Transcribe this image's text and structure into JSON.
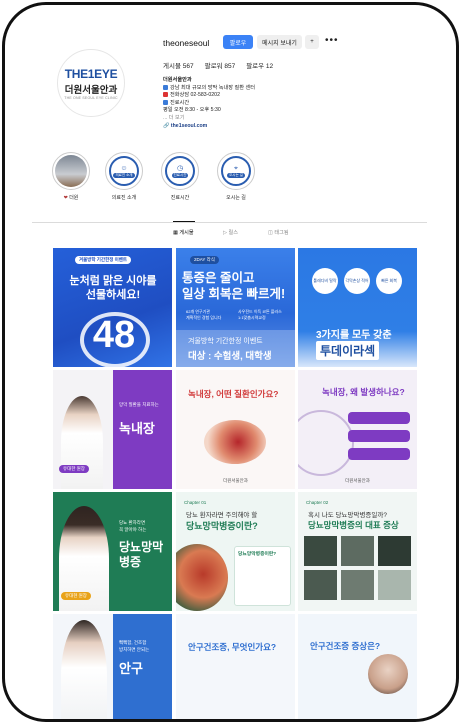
{
  "profile": {
    "username": "theoneseoul",
    "follow_label": "팔로우",
    "message_label": "메시지 보내기",
    "person_icon": "+",
    "more_icon": "•••",
    "avatar_logo": "THE1EYE",
    "avatar_name": "더원서울안과",
    "avatar_sub": "THE ONE SEOUL EYE CLINIC",
    "stats": {
      "posts": "게시물 567",
      "followers": "팔로워 857",
      "following": "팔로우 12"
    },
    "bio": {
      "name": "더원서울안과",
      "line1": "강남 최대 규모의 망막 녹내장 질환 센터",
      "line2": "전화상담 02-583-0202",
      "line3": "진료시간",
      "line4": "평일 오전 8:30 - 오후 5:30",
      "more": "... 더 보기",
      "link": "the1seoul.com"
    }
  },
  "highlights": [
    {
      "label": "더원",
      "type": "photo"
    },
    {
      "label": "의료진 소개",
      "type": "badge",
      "badge": "의료진 소개"
    },
    {
      "label": "진료시간",
      "type": "badge",
      "badge": "진료시간"
    },
    {
      "label": "오시는 길",
      "type": "badge",
      "badge": "오시는 길"
    }
  ],
  "tabs": [
    {
      "label": "게시물",
      "active": true
    },
    {
      "label": "릴스",
      "active": false
    },
    {
      "label": "태그됨",
      "active": false
    }
  ],
  "posts": {
    "p1": {
      "tag": "겨울방학 기간한정 이벤트",
      "l1": "눈처럼 맑은 시야를",
      "l2": "선물하세요!",
      "big": "48"
    },
    "p2": {
      "tag": "2DAY 라식",
      "l1": "통증은 줄이고",
      "l2": "일상 회복은 빠르게!",
      "a1": "62개 연구기관",
      "a2": "계획적인 경험 입니다",
      "b1": "사우전드 이득 코튼 플러스",
      "b2": "1:1맞춤시력교정",
      "e1": "겨울방학 기간한정 이벤트",
      "e2": "대상 : 수험생, 대학생"
    },
    "p3": {
      "c1": "톨레디비 탈락",
      "c2": "각막손상 적어",
      "c3": "빠른 회복",
      "l1": "3가지를 모두 갖춘",
      "l2": "투데이라섹"
    },
    "p4": {
      "small1": "망막 질환을 치료하는",
      "small2": "녹내장",
      "big": "녹내장",
      "badge": "유대한 원장"
    },
    "p5": {
      "l1": "녹내장, 어떤 질환인가요?",
      "footer": "더원서울안과"
    },
    "p6": {
      "l1": "녹내장, 왜 발생하나요?",
      "footer": "더원서울안과"
    },
    "p7": {
      "small1": "당뇨 환자라면",
      "small2": "꼭 알아야 하는",
      "big1": "당뇨망막",
      "big2": "병증",
      "badge": "유대현 원장"
    },
    "p8": {
      "chapter": "Chapter 01",
      "l1": "당뇨 환자라면 주의해야 할",
      "l2": "당뇨망막병증이란?",
      "box": "당뇨망막병증이란?"
    },
    "p9": {
      "chapter": "Chapter 02",
      "l1": "혹시 나도 당뇨망막병증일까?",
      "l2": "당뇨망막병증의 대표 증상"
    },
    "p10": {
      "small1": "뻑뻑함, 건조함",
      "small2": "방치하면 안되는",
      "big": "안구"
    },
    "p11": {
      "l1": "안구건조증, 무엇인가요?"
    },
    "p12": {
      "l1": "안구건조증 증상은?"
    }
  },
  "colors": {
    "follow_blue": "#3b82f6",
    "brand_blue": "#1e4fa0",
    "purple": "#7e3bc2",
    "green": "#1f7c55"
  }
}
